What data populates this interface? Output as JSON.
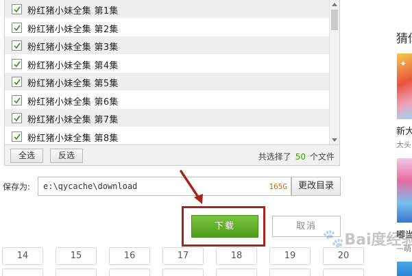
{
  "file_list": {
    "items": [
      {
        "name": "粉红猪小妹全集",
        "episode": "第1集",
        "checked": true
      },
      {
        "name": "粉红猪小妹全集",
        "episode": "第2集",
        "checked": true
      },
      {
        "name": "粉红猪小妹全集",
        "episode": "第3集",
        "checked": true
      },
      {
        "name": "粉红猪小妹全集",
        "episode": "第4集",
        "checked": true
      },
      {
        "name": "粉红猪小妹全集",
        "episode": "第5集",
        "checked": true
      },
      {
        "name": "粉红猪小妹全集",
        "episode": "第6集",
        "checked": true
      },
      {
        "name": "粉红猪小妹全集",
        "episode": "第7集",
        "checked": true
      },
      {
        "name": "粉红猪小妹全集",
        "episode": "第8集",
        "checked": true
      }
    ]
  },
  "footer": {
    "select_all_label": "全选",
    "invert_label": "反选",
    "summary_prefix": "共选择了",
    "selected_count": "50",
    "summary_suffix": "个文件"
  },
  "save": {
    "label": "保存为:",
    "path": "e:\\qycache\\download",
    "free_space": "165G",
    "change_dir_label": "更改目录"
  },
  "actions": {
    "download_label": "下载",
    "cancel_label": "取消"
  },
  "episodes": [
    "14",
    "15",
    "16",
    "17",
    "18",
    "19",
    "20"
  ],
  "sidebar": {
    "title": "猜你",
    "item1_title": "新大",
    "item1_sub": "大头",
    "item2_title": "嘟当",
    "item2_sub": "一萌"
  },
  "watermark": "Bai度经验",
  "colors": {
    "accent_green": "#5aaa24",
    "count_green": "#3aa100",
    "highlight_red": "#a5241c",
    "free_space_orange": "#c8671c"
  }
}
